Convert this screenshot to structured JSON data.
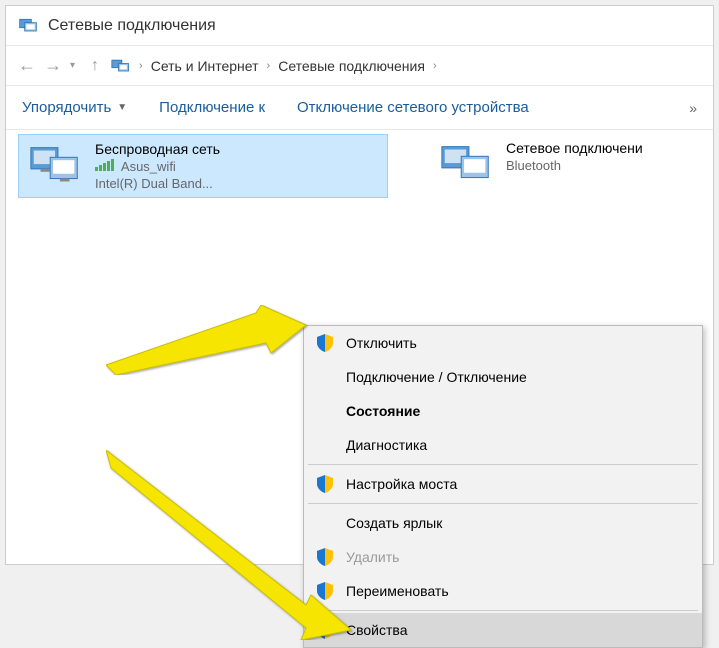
{
  "window": {
    "title": "Сетевые подключения"
  },
  "breadcrumb": {
    "items": [
      "Сеть и Интернет",
      "Сетевые подключения"
    ]
  },
  "toolbar": {
    "organize": "Упорядочить",
    "connect_to": "Подключение к",
    "disable_device": "Отключение сетевого устройства"
  },
  "adapters": [
    {
      "title": "Беспроводная сеть",
      "sub1": "Asus_wifi",
      "sub2": "Intel(R) Dual Band..."
    },
    {
      "title": "Сетевое подключени",
      "sub1": "Bluetooth"
    }
  ],
  "context_menu": {
    "disable": "Отключить",
    "connect_disconnect": "Подключение / Отключение",
    "status": "Состояние",
    "diagnose": "Диагностика",
    "bridge": "Настройка моста",
    "shortcut": "Создать ярлык",
    "delete": "Удалить",
    "rename": "Переименовать",
    "properties": "Свойства"
  }
}
